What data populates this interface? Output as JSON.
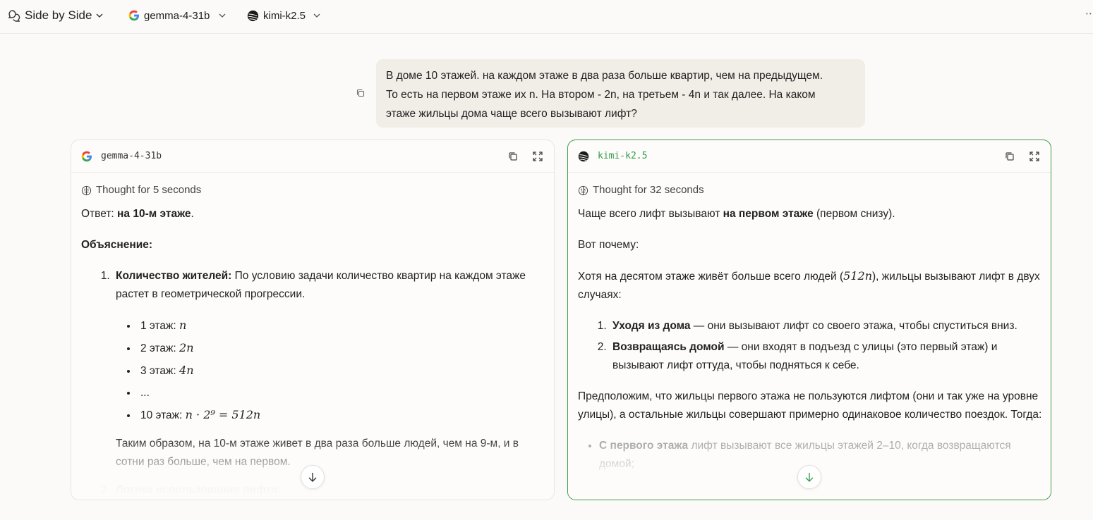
{
  "topbar": {
    "mode_label": "Side by Side",
    "model_a": "gemma-4-31b",
    "model_b": "kimi-k2.5",
    "more": "⋯"
  },
  "user_message": {
    "line1": "В доме 10 этажей. на каждом этаже в два раза больше квартир, чем на предыдущем.",
    "line2": "То есть на первом этаже их n. На втором - 2n, на третьем - 4n и так далее. На каком",
    "line3": "этаже жильцы дома чаще всего вызывают лифт?"
  },
  "left": {
    "name": "gemma-4-31b",
    "thought": "Thought for 5 seconds",
    "answer_prefix": "Ответ: ",
    "answer_bold": "на 10-м этаже",
    "answer_suffix": ".",
    "explanation": "Объяснение:",
    "item1_bold": "Количество жителей:",
    "item1_text": " По условию задачи количество квартир на каждом этаже растет в геометрической прогрессии.",
    "floors": [
      {
        "label": "1 этаж: ",
        "math": "n"
      },
      {
        "label": "2 этаж: ",
        "math": "2n"
      },
      {
        "label": "3 этаж: ",
        "math": "4n"
      },
      {
        "label": "...",
        "math": ""
      },
      {
        "label": "10 этаж: ",
        "math": "n · 2⁹ = 512n"
      }
    ],
    "conclusion": "Таким образом, на 10-м этаже живет в два раза больше людей, чем на 9-м, и в сотни раз больше, чем на первом.",
    "item2_bold": "Логика использования лифта:"
  },
  "right": {
    "name": "kimi-k2.5",
    "thought": "Thought for 32 seconds",
    "p1_prefix": "Чаще всего лифт вызывают ",
    "p1_bold": "на первом этаже",
    "p1_suffix": " (первом снизу).",
    "p2": "Вот почему:",
    "p3_prefix": "Хотя на десятом этаже живёт больше всего людей (",
    "p3_math": "512n",
    "p3_suffix": "), жильцы вызывают лифт в двух случаях:",
    "li1_bold": "Уходя из дома",
    "li1_text": " — они вызывают лифт со своего этажа, чтобы спуститься вниз.",
    "li2_bold": "Возвращаясь домой",
    "li2_text": " — они входят в подъезд с улицы (это первый этаж) и вызывают лифт оттуда, чтобы подняться к себе.",
    "p4": "Предположим, что жильцы первого этажа не пользуются лифтом (они и так уже на уровне улицы), а остальные жильцы совершают примерно одинаковое количество поездок. Тогда:",
    "b1_bold": "С первого этажа",
    "b1_text": " лифт вызывают все жильцы этажей 2–10, когда возвращаются домой;"
  },
  "colors": {
    "accent_green": "#3aa04a",
    "bubble_bg": "#f1ede7"
  }
}
